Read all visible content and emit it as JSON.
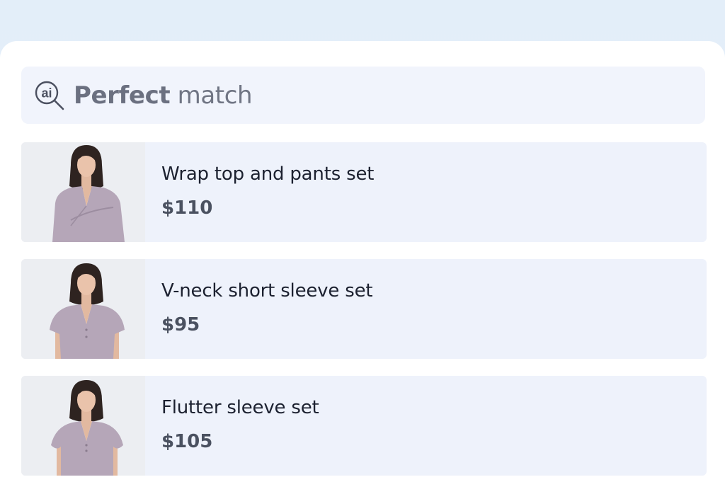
{
  "search": {
    "icon": "ai-search-icon",
    "query_bold": "Perfect",
    "query_rest": "match"
  },
  "results": [
    {
      "name": "Wrap top and pants set",
      "price": "$110",
      "image": "model-wrap-top-photo"
    },
    {
      "name": "V-neck short sleeve set",
      "price": "$95",
      "image": "model-vneck-top-photo"
    },
    {
      "name": "Flutter sleeve set",
      "price": "$105",
      "image": "model-flutter-top-photo"
    }
  ],
  "colors": {
    "background": "#e3eef9",
    "card": "#eef2fb",
    "garment": "#b5a6b8",
    "text_primary": "#1c2130",
    "text_secondary": "#4a5160"
  }
}
